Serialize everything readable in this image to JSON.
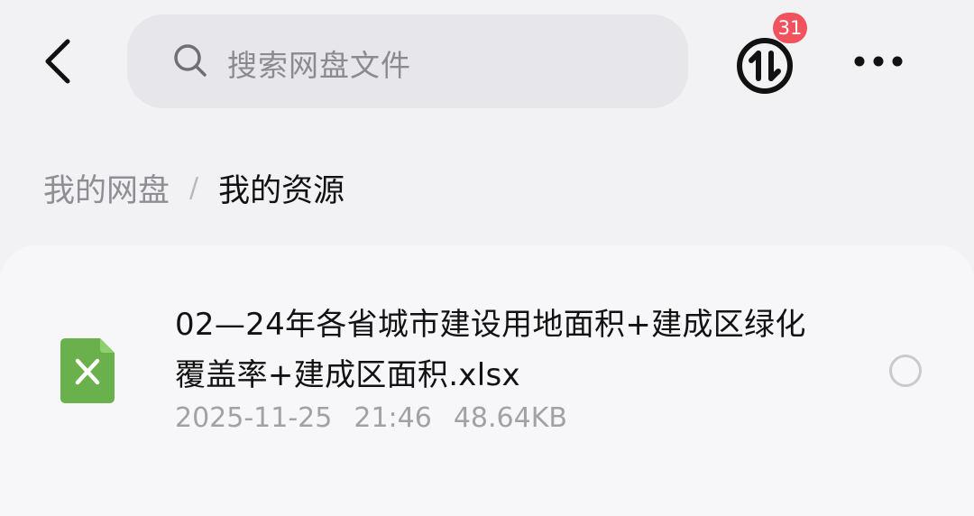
{
  "header": {
    "search_placeholder": "搜索网盘文件",
    "transfer_badge_count": "31",
    "icons": {
      "back": "back-chevron-icon",
      "search": "search-icon",
      "transfer": "transfer-updown-icon",
      "more": "more-horizontal-icon"
    }
  },
  "breadcrumb": {
    "root": "我的网盘",
    "separator": "/",
    "current": "我的资源"
  },
  "files": [
    {
      "name": "02—24年各省城市建设用地面积+建成区绿化覆盖率+建成区面积.xlsx",
      "date": "2025-11-25",
      "time": "21:46",
      "size": "48.64KB",
      "icon": "excel-file-icon",
      "selected": false
    }
  ],
  "colors": {
    "background": "#f2f2f4",
    "search_bg": "#e7e7eb",
    "badge": "#f0525e",
    "excel_green": "#6ab04c",
    "text_primary": "#121212",
    "text_secondary": "#a1a1a6"
  }
}
